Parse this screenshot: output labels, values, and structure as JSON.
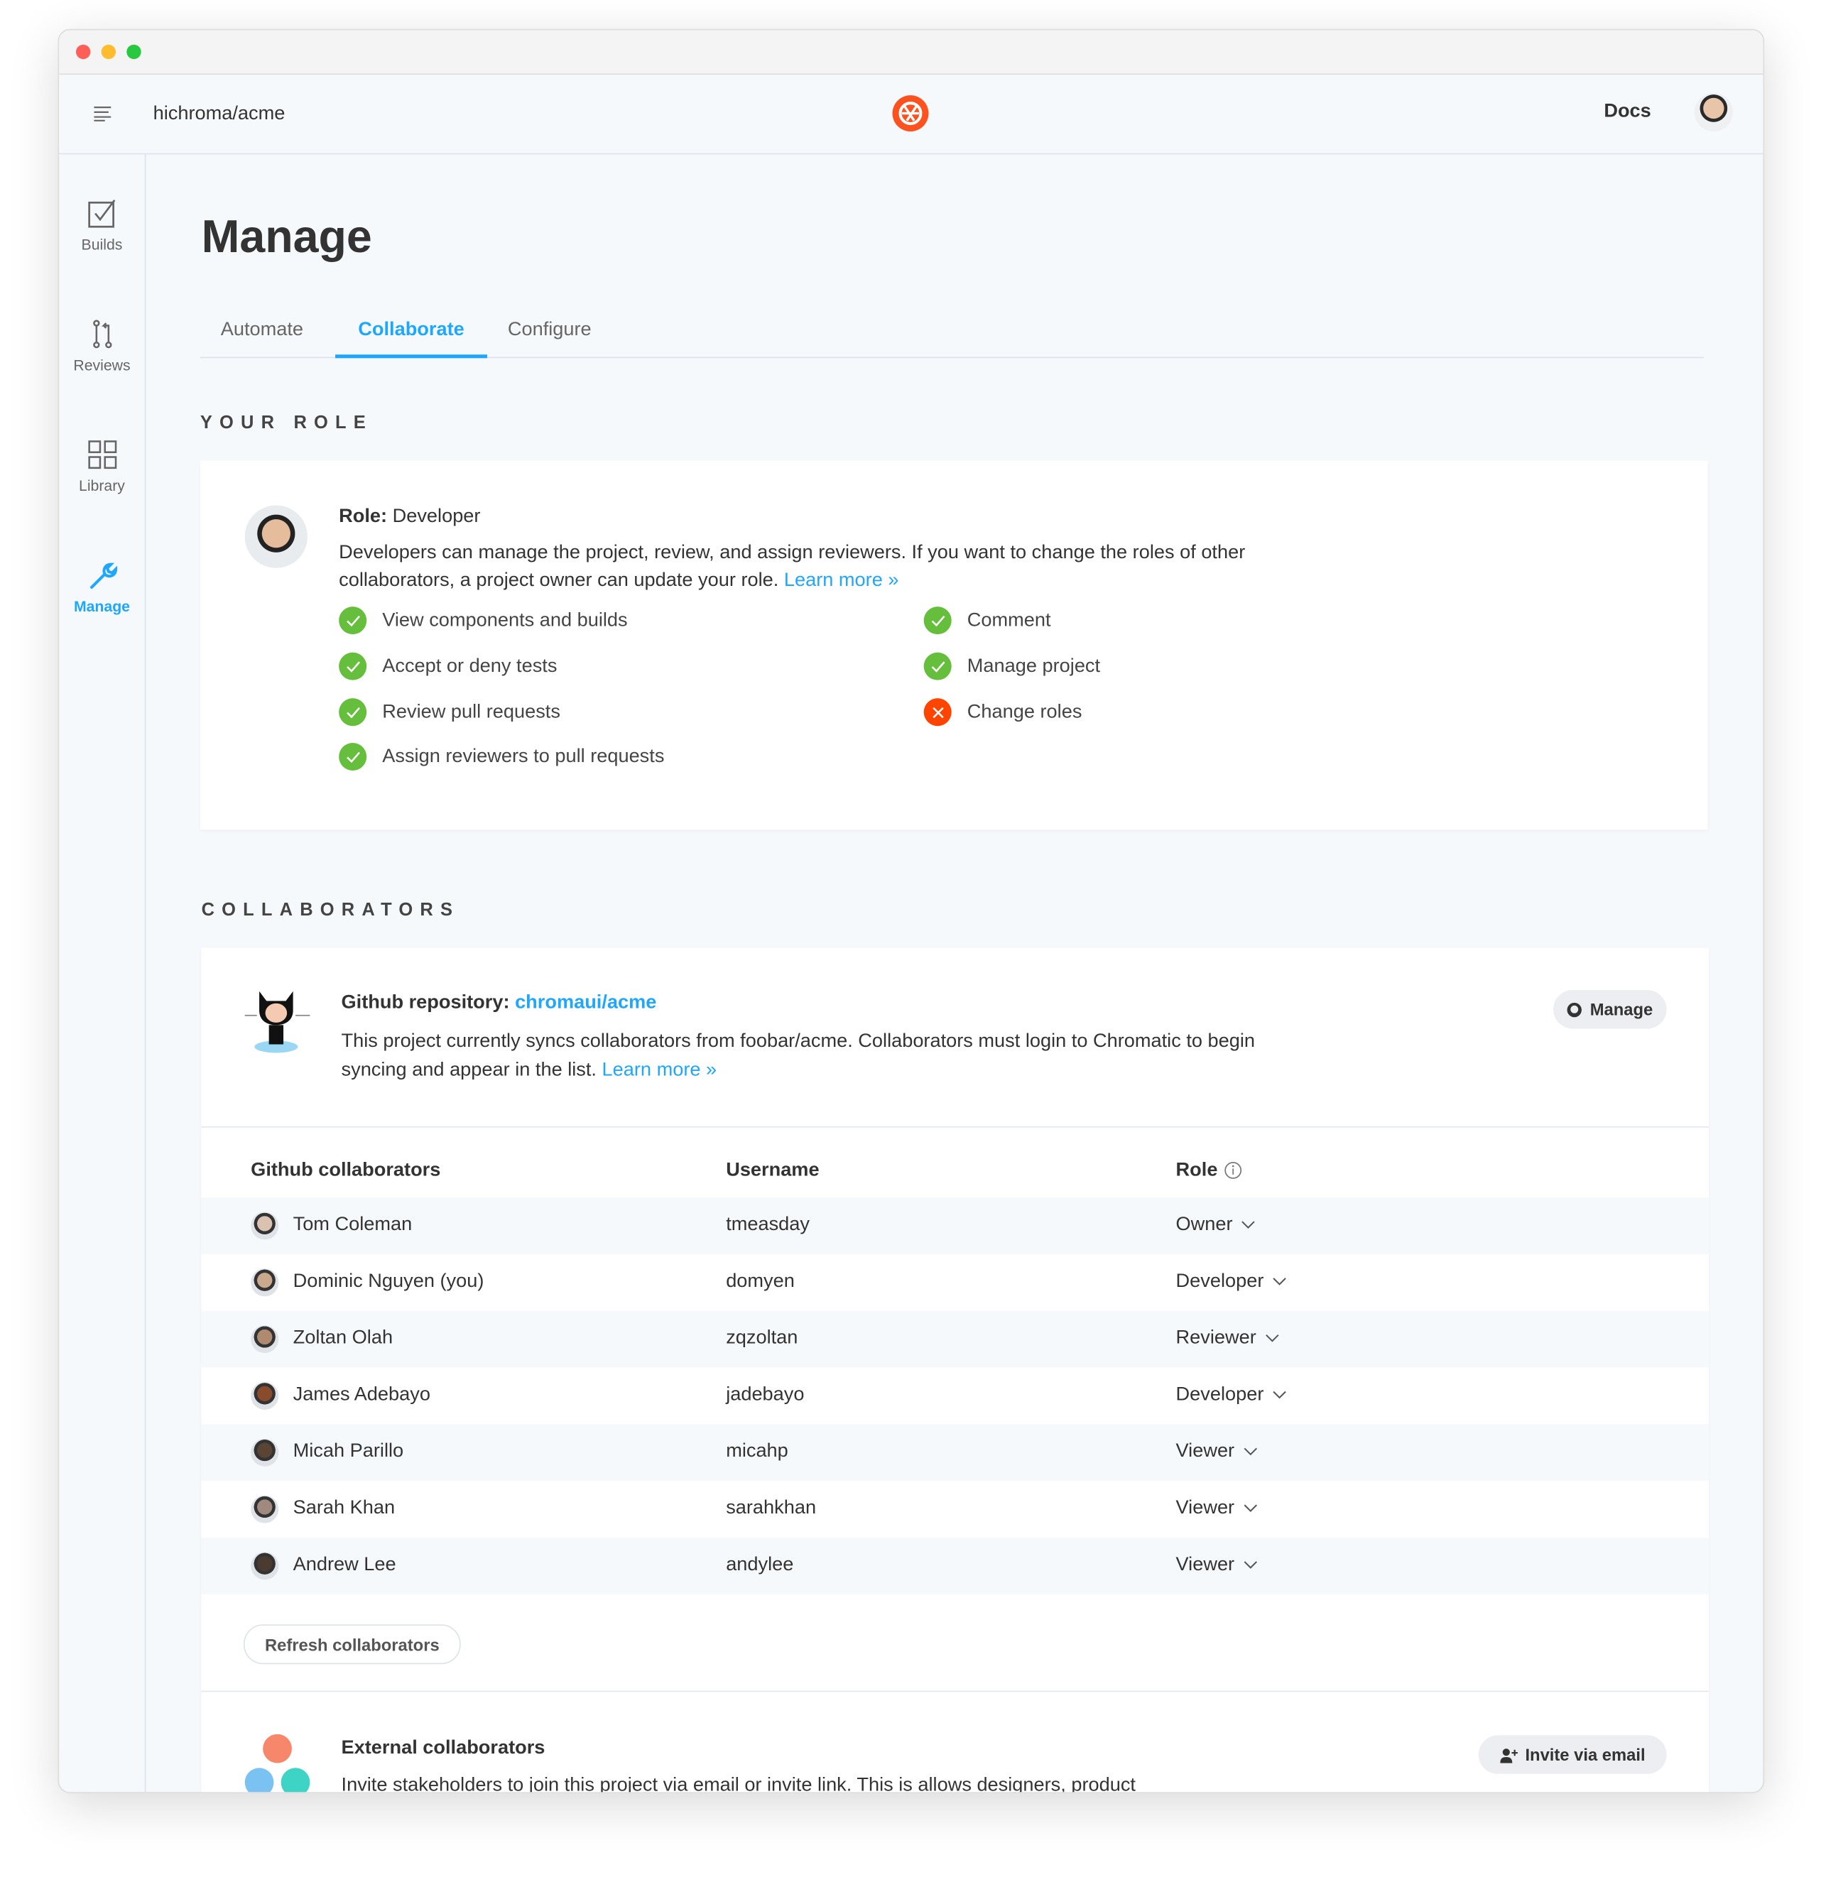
{
  "header": {
    "repo": "hichroma/acme",
    "docs_label": "Docs"
  },
  "sidebar": {
    "items": [
      {
        "label": "Builds",
        "icon": "checkbox-icon"
      },
      {
        "label": "Reviews",
        "icon": "pull-request-icon"
      },
      {
        "label": "Library",
        "icon": "grid-icon"
      },
      {
        "label": "Manage",
        "icon": "wrench-icon",
        "active": true
      }
    ]
  },
  "page": {
    "title": "Manage",
    "tabs": [
      "Automate",
      "Collaborate",
      "Configure"
    ],
    "active_tab": "Collaborate"
  },
  "role": {
    "section": "YOUR ROLE",
    "label": "Role:",
    "value": "Developer",
    "description": "Developers can manage the project, review, and assign reviewers. If you want to change the roles of other collaborators, a project owner can update your role.",
    "learn_more": "Learn more »",
    "permissions": [
      {
        "label": "View components and builds",
        "allowed": true
      },
      {
        "label": "Accept or deny tests",
        "allowed": true
      },
      {
        "label": "Review pull requests",
        "allowed": true
      },
      {
        "label": "Assign reviewers to pull requests",
        "allowed": true
      },
      {
        "label": "Comment",
        "allowed": true
      },
      {
        "label": "Manage project",
        "allowed": true
      },
      {
        "label": "Change roles",
        "allowed": false
      }
    ]
  },
  "collaborators": {
    "section": "COLLABORATORS",
    "repo_label": "Github repository:",
    "repo_link": "chromaui/acme",
    "manage_button": "Manage",
    "description": "This project currently syncs collaborators from foobar/acme. Collaborators must login to Chromatic to begin syncing and appear in the list.",
    "learn_more": "Learn more »",
    "columns": [
      "Github collaborators",
      "Username",
      "Role"
    ],
    "rows": [
      {
        "name": "Tom Coleman",
        "username": "tmeasday",
        "role": "Owner"
      },
      {
        "name": "Dominic Nguyen (you)",
        "username": "domyen",
        "role": "Developer"
      },
      {
        "name": "Zoltan Olah",
        "username": "zqzoltan",
        "role": "Reviewer"
      },
      {
        "name": "James Adebayo",
        "username": "jadebayo",
        "role": "Developer"
      },
      {
        "name": "Micah Parillo",
        "username": "micahp",
        "role": "Viewer"
      },
      {
        "name": "Sarah Khan",
        "username": "sarahkhan",
        "role": "Viewer"
      },
      {
        "name": "Andrew Lee",
        "username": "andylee",
        "role": "Viewer"
      }
    ],
    "refresh_button": "Refresh collaborators",
    "external_title": "External collaborators",
    "external_description": "Invite stakeholders to join this project via email or invite link. This is allows designers, product",
    "invite_button": "Invite via email"
  },
  "colors": {
    "accent": "#1ea7fd",
    "success": "#66bf3c",
    "error": "#ff4400",
    "logo": "#fc521f"
  }
}
